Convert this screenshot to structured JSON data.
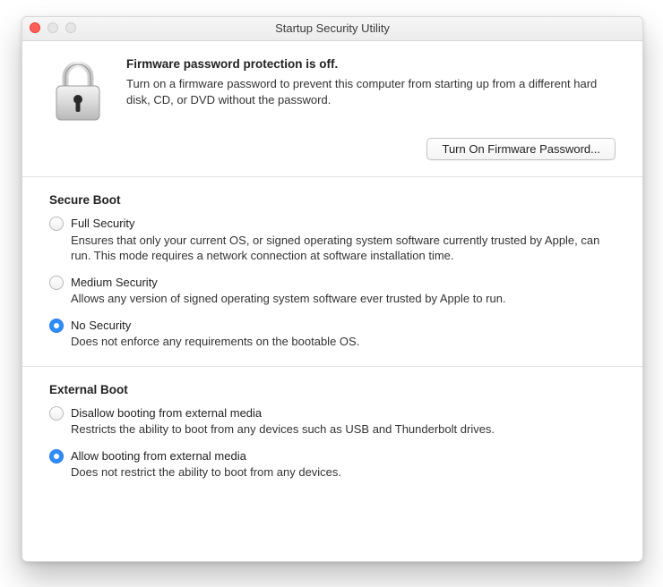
{
  "window": {
    "title": "Startup Security Utility"
  },
  "firmware": {
    "title": "Firmware password protection is off.",
    "desc": "Turn on a firmware password to prevent this computer from starting up from a different hard disk, CD, or DVD without the password.",
    "button": "Turn On Firmware Password..."
  },
  "secure_boot": {
    "title": "Secure Boot",
    "options": [
      {
        "label": "Full Security",
        "desc": "Ensures that only your current OS, or signed operating system software currently trusted by Apple, can run. This mode requires a network connection at software installation time.",
        "selected": false
      },
      {
        "label": "Medium Security",
        "desc": "Allows any version of signed operating system software ever trusted by Apple to run.",
        "selected": false
      },
      {
        "label": "No Security",
        "desc": "Does not enforce any requirements on the bootable OS.",
        "selected": true
      }
    ]
  },
  "external_boot": {
    "title": "External Boot",
    "options": [
      {
        "label": "Disallow booting from external media",
        "desc": "Restricts the ability to boot from any devices such as USB and Thunderbolt drives.",
        "selected": false
      },
      {
        "label": "Allow booting from external media",
        "desc": "Does not restrict the ability to boot from any devices.",
        "selected": true
      }
    ]
  }
}
